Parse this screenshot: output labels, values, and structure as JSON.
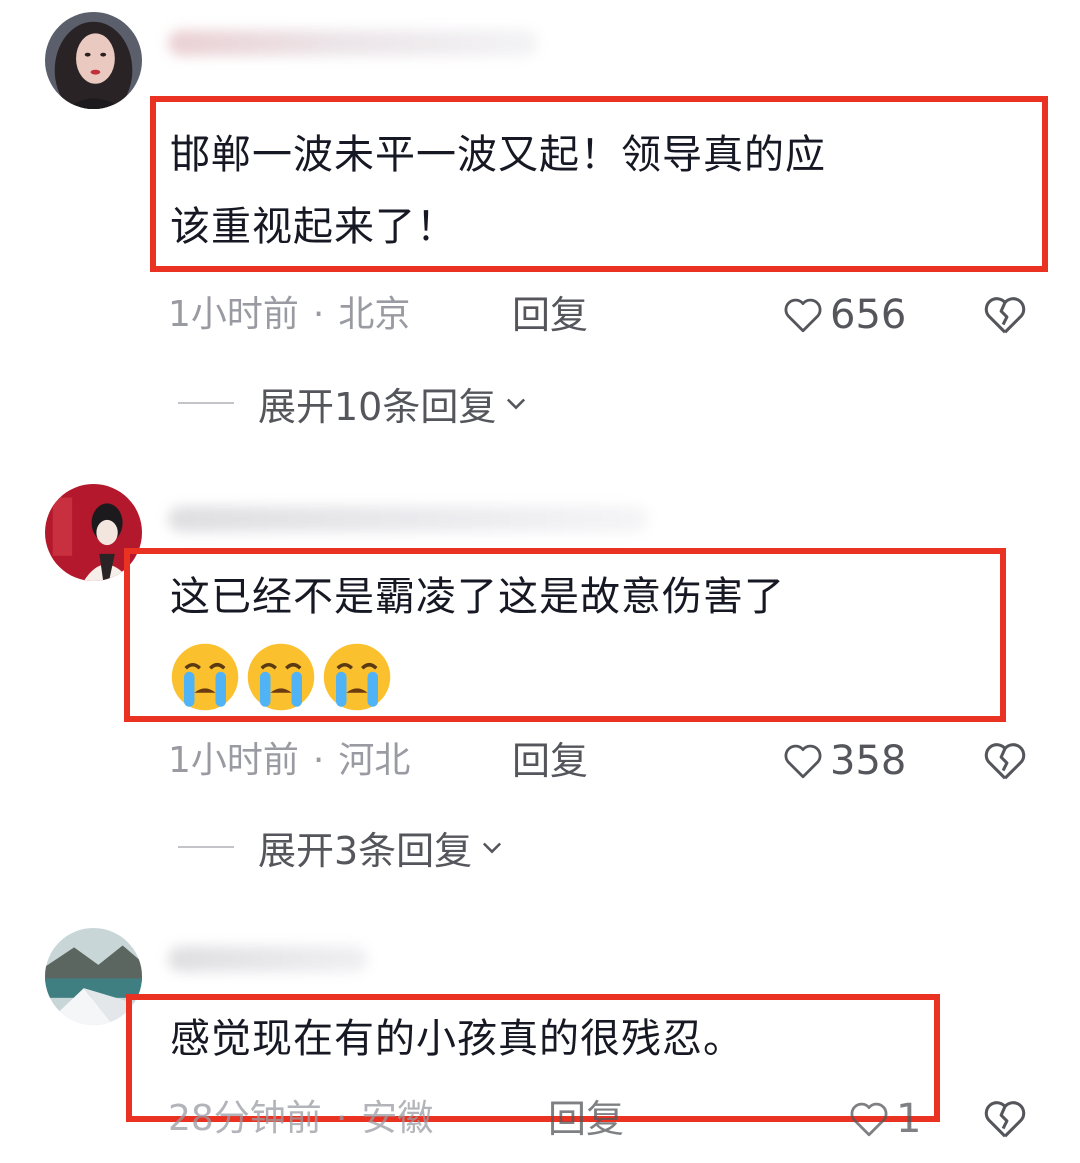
{
  "comments": [
    {
      "text_line1": "邯郸一波未平一波又起！领导真的应",
      "text_line2": "该重视起来了！",
      "time": "1小时前",
      "location": "北京",
      "reply_label": "回复",
      "likes": "656",
      "expand_label": "展开10条回复"
    },
    {
      "text_line1": "这已经不是霸凌了这是故意伤害了",
      "emoji_names": [
        "loudly-crying-face",
        "loudly-crying-face",
        "loudly-crying-face"
      ],
      "time": "1小时前",
      "location": "河北",
      "reply_label": "回复",
      "likes": "358",
      "expand_label": "展开3条回复"
    },
    {
      "text_line1": "感觉现在有的小孩真的很残忍。",
      "time": "28分钟前",
      "location": "安徽",
      "reply_label": "回复",
      "likes": "1"
    }
  ],
  "colors": {
    "highlight_box": "#ea3223",
    "meta_text": "#9a9ba2",
    "body_text": "#161823"
  }
}
